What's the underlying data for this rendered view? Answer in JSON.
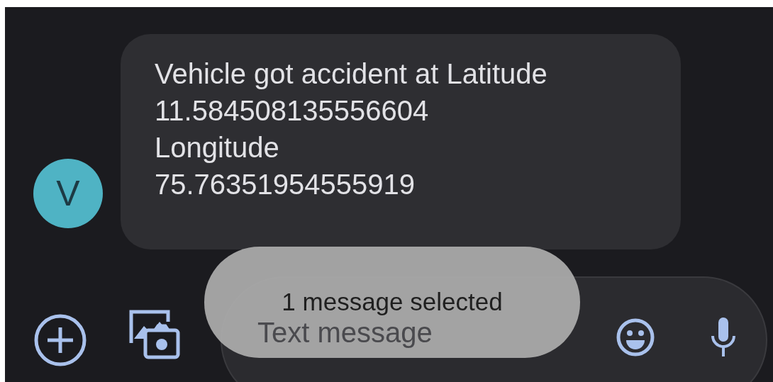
{
  "message": {
    "avatar": "V",
    "text_lines": [
      "Vehicle got accident at Latitude",
      "11.584508135556604",
      "Longitude",
      "75.76351954555919"
    ]
  },
  "composer": {
    "placeholder": "Text message"
  },
  "toast": "1 message selected"
}
